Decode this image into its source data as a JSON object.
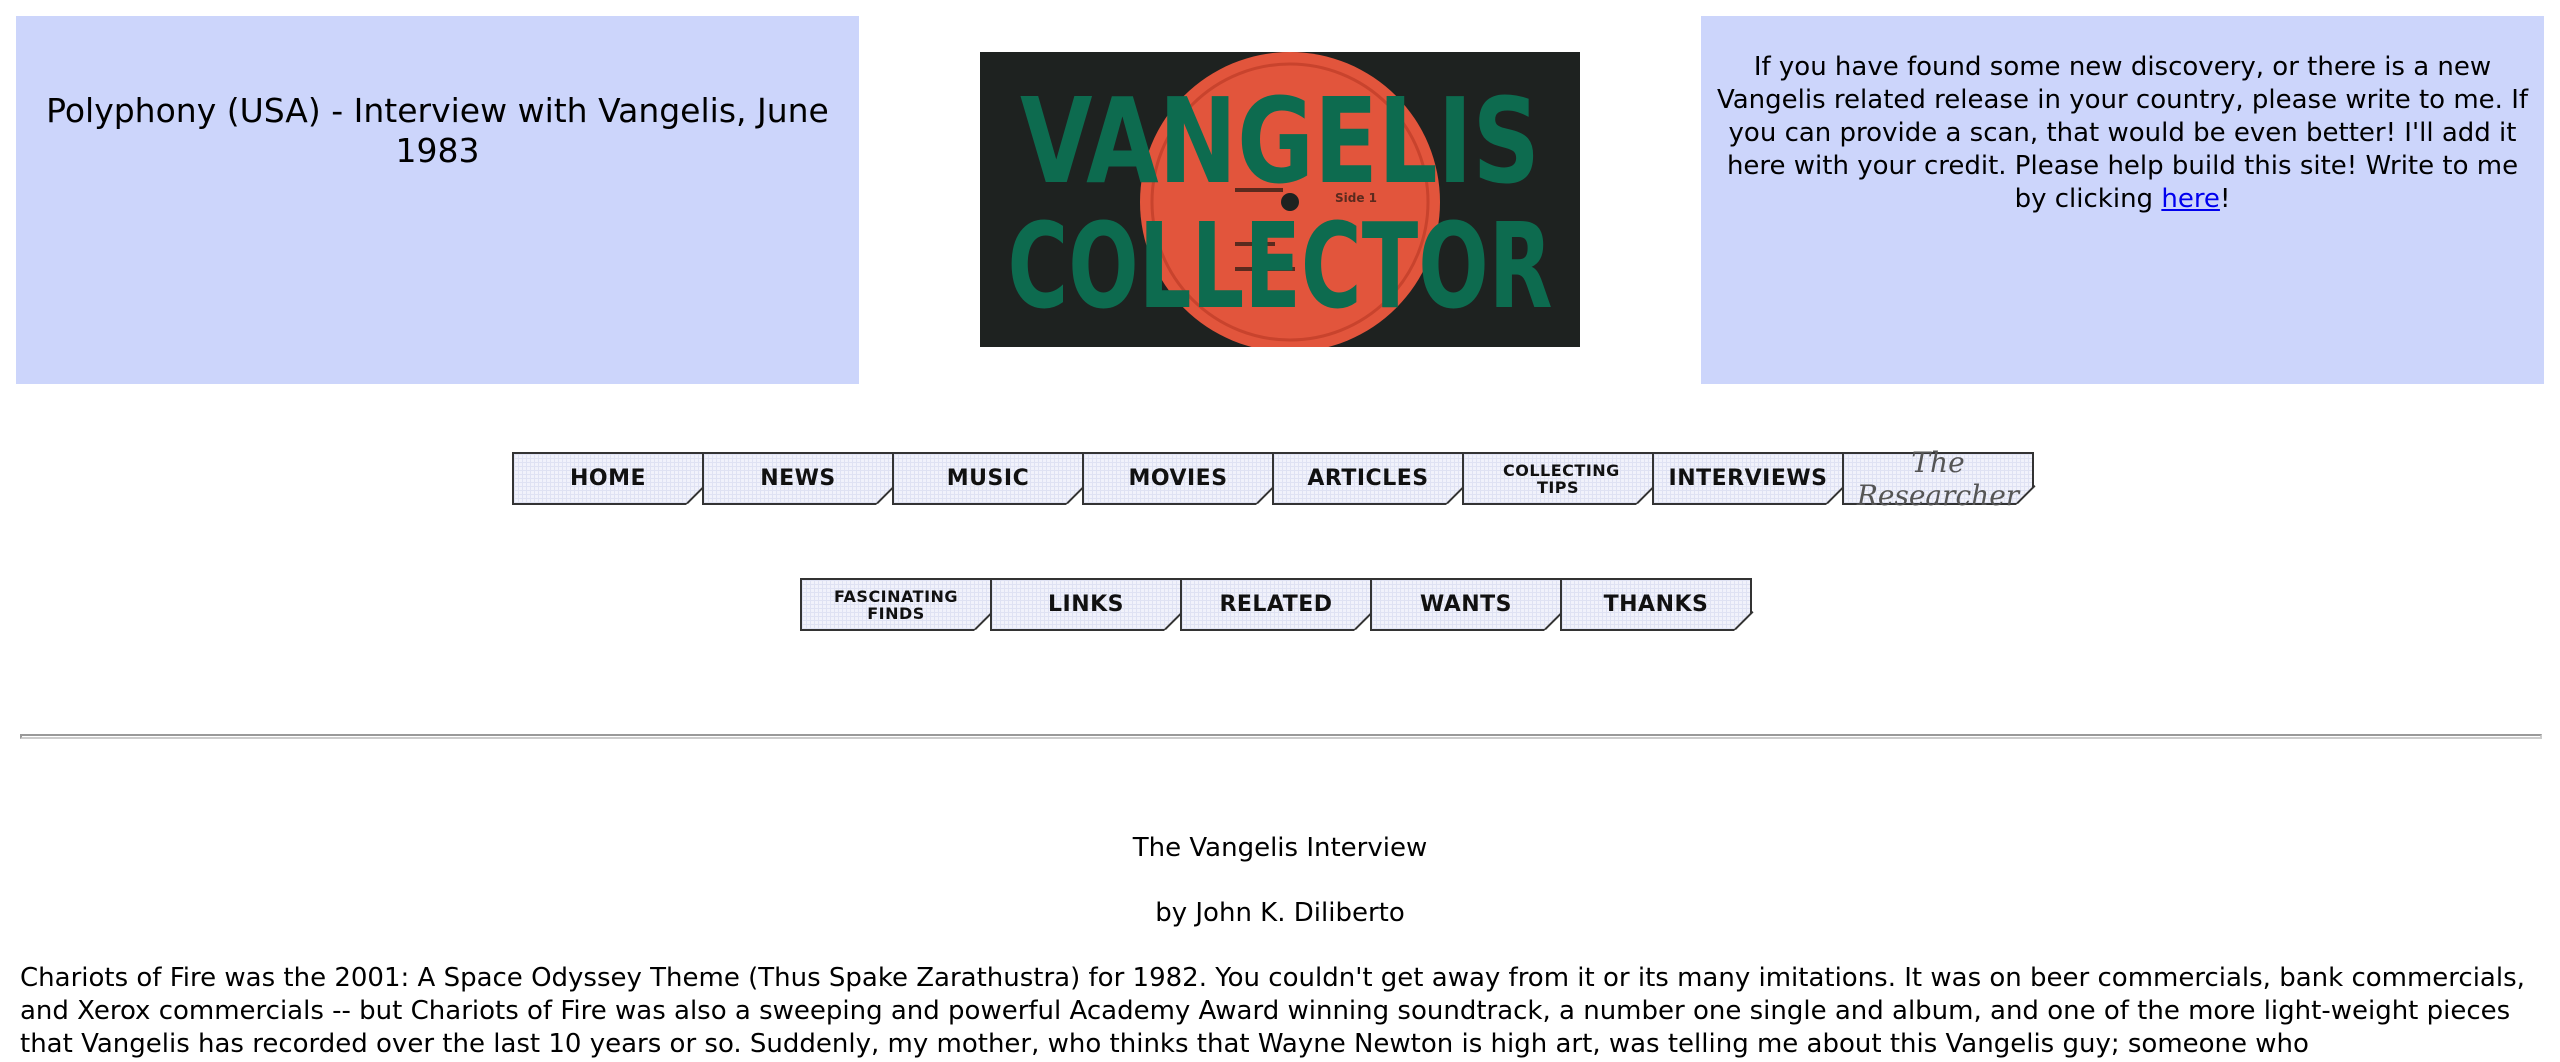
{
  "header": {
    "title": "Polyphony (USA) - Interview with Vangelis, June 1983"
  },
  "logo": {
    "line1": "VANGELIS",
    "line2": "COLLECTOR",
    "label_text": "Side 1"
  },
  "notice": {
    "text_before_link": "If you have found some new discovery, or there is a new Vangelis related release in your country, please write to me. If you can provide a scan, that would be even better! I'll add it here with your credit. Please help build this site! Write to me by clicking ",
    "link_label": "here",
    "text_after_link": "!"
  },
  "nav": {
    "row1": [
      {
        "label": "HOME"
      },
      {
        "label": "NEWS"
      },
      {
        "label": "MUSIC"
      },
      {
        "label": "MOVIES"
      },
      {
        "label": "ARTICLES"
      },
      {
        "label": "COLLECTING TIPS"
      },
      {
        "label": "INTERVIEWS"
      },
      {
        "label": "The Researcher"
      }
    ],
    "row2": [
      {
        "label": "FASCINATING FINDS"
      },
      {
        "label": "LINKS"
      },
      {
        "label": "RELATED"
      },
      {
        "label": "WANTS"
      },
      {
        "label": "THANKS"
      }
    ]
  },
  "article": {
    "heading": "The Vangelis Interview",
    "byline": "by John K. Diliberto",
    "body": "Chariots of Fire was the 2001:  A Space Odyssey Theme (Thus Spake Zarathustra) for 1982.  You couldn't get away from it or its many imitations.  It was on beer commercials, bank commercials, and Xerox commercials -- but Chariots of Fire was also a sweeping and powerful Academy Award winning soundtrack, a number one single and album, and one of the more light-weight pieces that Vangelis has recorded over the last 10 years or so.  Suddenly, my mother, who thinks that Wayne Newton is high art, was telling me about this Vangelis guy; someone who"
  },
  "colors": {
    "panel_bg": "#ccd5fb",
    "logo_bg": "#1e2220",
    "logo_text": "#0d6b4f",
    "record_label": "#e2553c",
    "link": "#0000ee"
  }
}
